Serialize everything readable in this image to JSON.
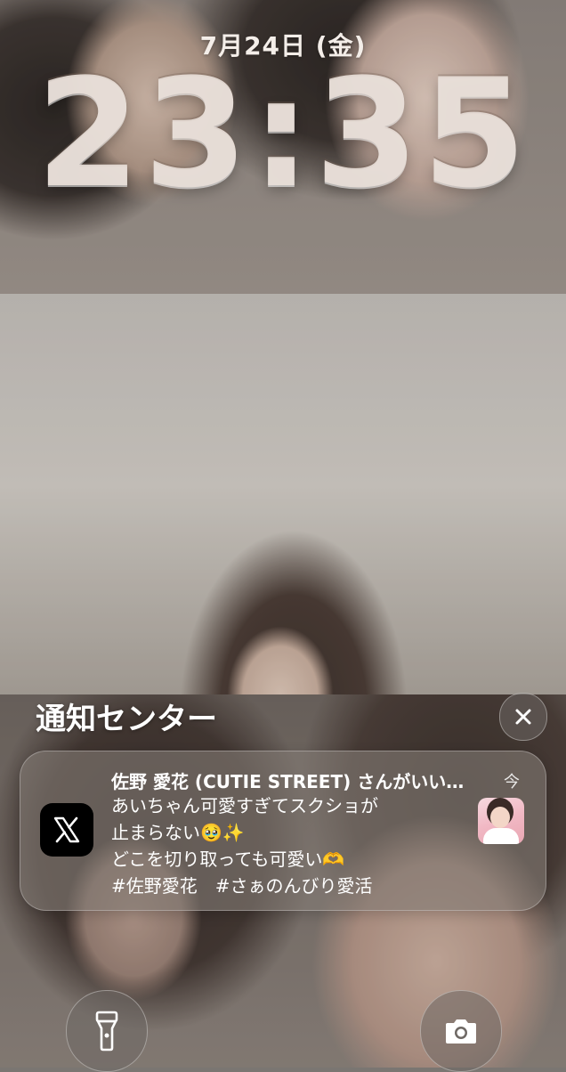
{
  "lockscreen": {
    "date": "7月24日 (金)",
    "time": "23:35"
  },
  "notification_center": {
    "title": "通知センター",
    "close_icon": "close-icon"
  },
  "notification": {
    "app_icon": "x-app-icon",
    "title": "佐野 愛花 (CUTIE STREET) さんがいい…",
    "time": "今",
    "body_lines": [
      "あいちゃん可愛すぎてスクショが",
      "止まらない🥹✨",
      "どこを切り取っても可愛い🫶",
      "#佐野愛花　#さぁのんびり愛活"
    ],
    "thumbnail": "photo-thumbnail"
  },
  "quick_actions": {
    "left_icon": "flashlight-icon",
    "right_icon": "camera-icon"
  }
}
